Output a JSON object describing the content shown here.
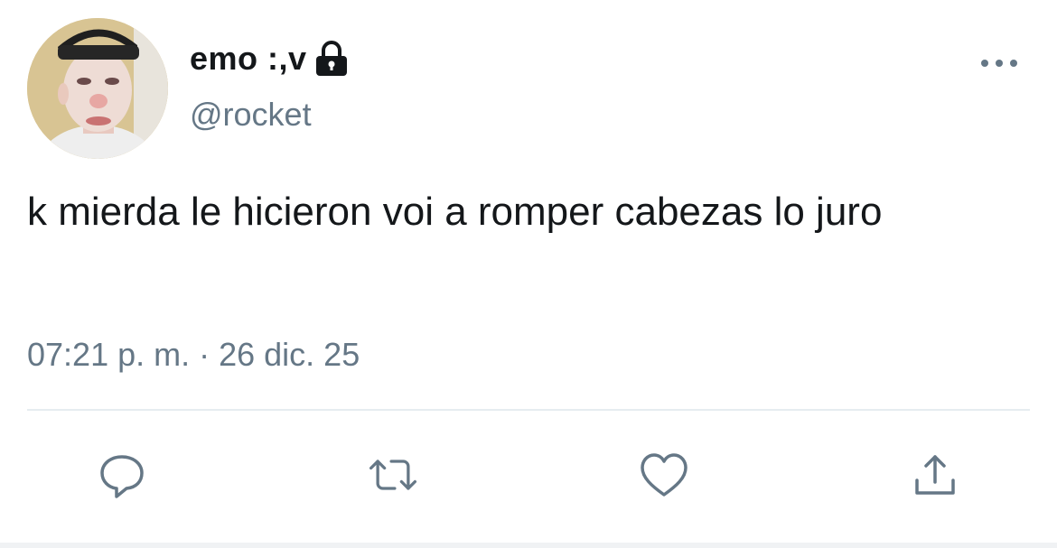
{
  "user": {
    "display_name": "emo :,v",
    "handle": "@rocket",
    "avatar_icon": "user-avatar-photo",
    "protected_icon": "lock-icon"
  },
  "tweet": {
    "text": "k mierda le hicieron voi a romper cabezas lo juro",
    "timestamp": "07:21 p. m. · 26 dic. 25"
  },
  "actions": [
    {
      "name": "reply",
      "icon": "comment-icon"
    },
    {
      "name": "retweet",
      "icon": "retweet-icon"
    },
    {
      "name": "like",
      "icon": "heart-icon"
    },
    {
      "name": "share",
      "icon": "share-icon"
    }
  ],
  "colors": {
    "text_primary": "#14171a",
    "text_secondary": "#657786",
    "divider": "#e6ecf0"
  }
}
